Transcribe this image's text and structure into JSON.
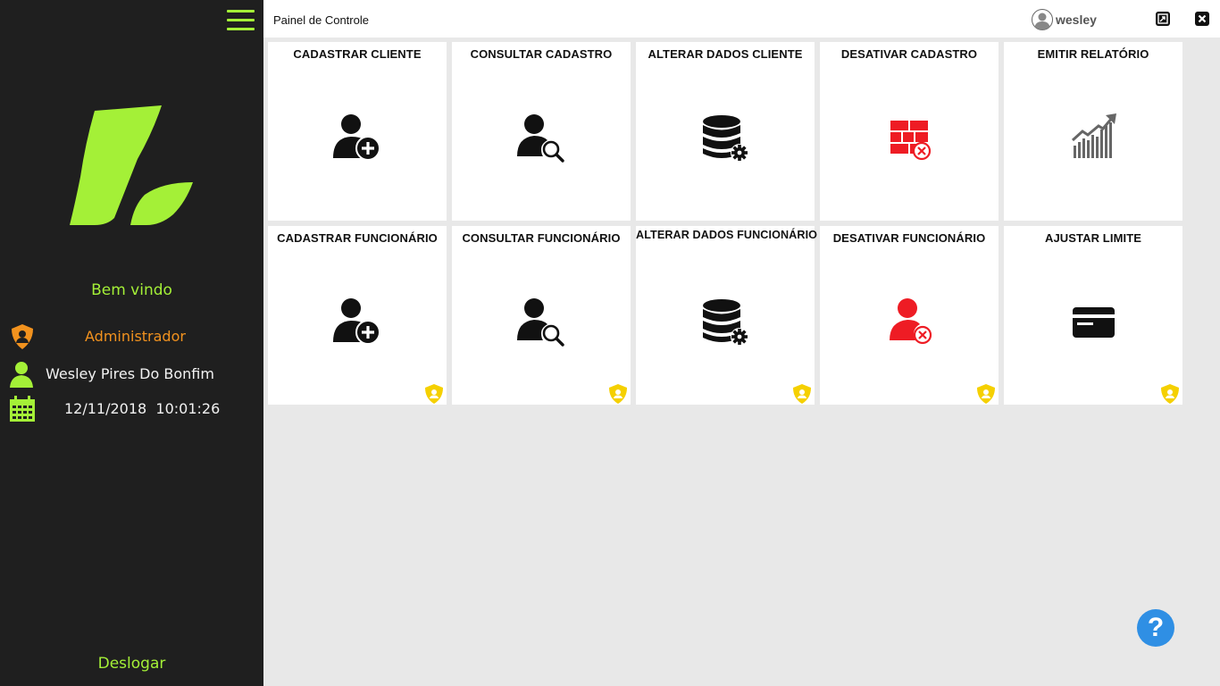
{
  "sidebar": {
    "welcome": "Bem vindo",
    "role": "Administrador",
    "user_name": "Wesley Pires Do Bonfim",
    "datetime": "12/11/2018  10:01:26",
    "logout": "Deslogar"
  },
  "header": {
    "title": "Painel de Controle",
    "username": "wesley"
  },
  "tiles": [
    {
      "label": "CADASTRAR CLIENTE",
      "icon": "user-add-icon"
    },
    {
      "label": "CONSULTAR CADASTRO",
      "icon": "user-search-icon"
    },
    {
      "label": "ALTERAR DADOS CLIENTE",
      "icon": "database-settings-icon"
    },
    {
      "label": "DESATIVAR CADASTRO",
      "icon": "table-remove-icon"
    },
    {
      "label": "EMITIR RELATÓRIO",
      "icon": "growth-chart-icon"
    },
    {
      "label": "CADASTRAR FUNCIONÁRIO",
      "icon": "user-add-icon"
    },
    {
      "label": "CONSULTAR FUNCIONÁRIO",
      "icon": "user-search-icon"
    },
    {
      "label": "ALTERAR DADOS FUNCIONÁRIO",
      "icon": "database-settings-icon"
    },
    {
      "label": "DESATIVAR FUNCIONÁRIO",
      "icon": "user-remove-icon"
    },
    {
      "label": "AJUSTAR LIMITE",
      "icon": "credit-card-icon"
    }
  ],
  "help": {
    "label": "?"
  },
  "colors": {
    "sidebar_bg": "#1f1f1f",
    "accent_green": "#a4f037",
    "role_orange": "#f2921e",
    "danger_red": "#ee1c24",
    "admin_badge_yellow": "#f5d000",
    "help_blue": "#2f8fe4"
  }
}
